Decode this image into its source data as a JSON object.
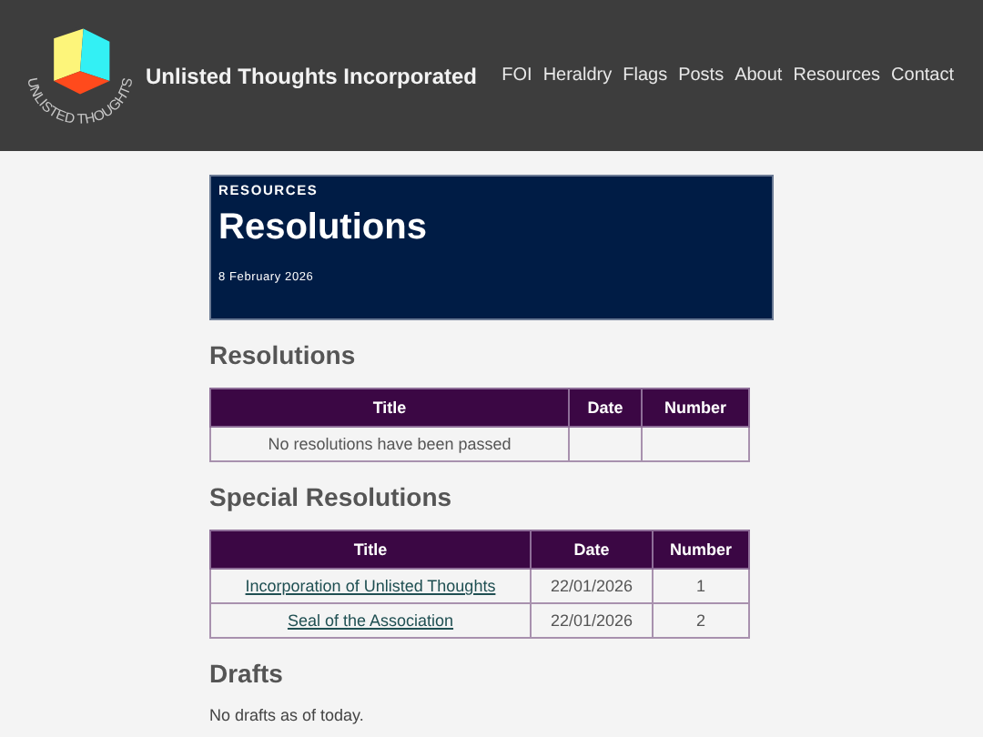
{
  "header": {
    "logo_text": "UNLISTED THOUGHTS",
    "site_title": "Unlisted Thoughts Incorporated",
    "nav": [
      "FOI",
      "Heraldry",
      "Flags",
      "Posts",
      "About",
      "Resources",
      "Contact"
    ]
  },
  "banner": {
    "category": "RESOURCES",
    "title": "Resolutions",
    "date": "8 February 2026"
  },
  "sections": [
    {
      "kind": "table",
      "heading": "Resolutions",
      "columns": [
        "Title",
        "Date",
        "Number"
      ],
      "empty_message": "No resolutions have been passed"
    },
    {
      "kind": "table",
      "heading": "Special Resolutions",
      "columns": [
        "Title",
        "Date",
        "Number"
      ],
      "rows": [
        {
          "title": "Incorporation of Unlisted Thoughts",
          "date": "22/01/2026",
          "number": "1"
        },
        {
          "title": "Seal of the Association",
          "date": "22/01/2026",
          "number": "2"
        }
      ]
    },
    {
      "kind": "text",
      "heading": "Drafts",
      "text": "No drafts as of today."
    }
  ]
}
